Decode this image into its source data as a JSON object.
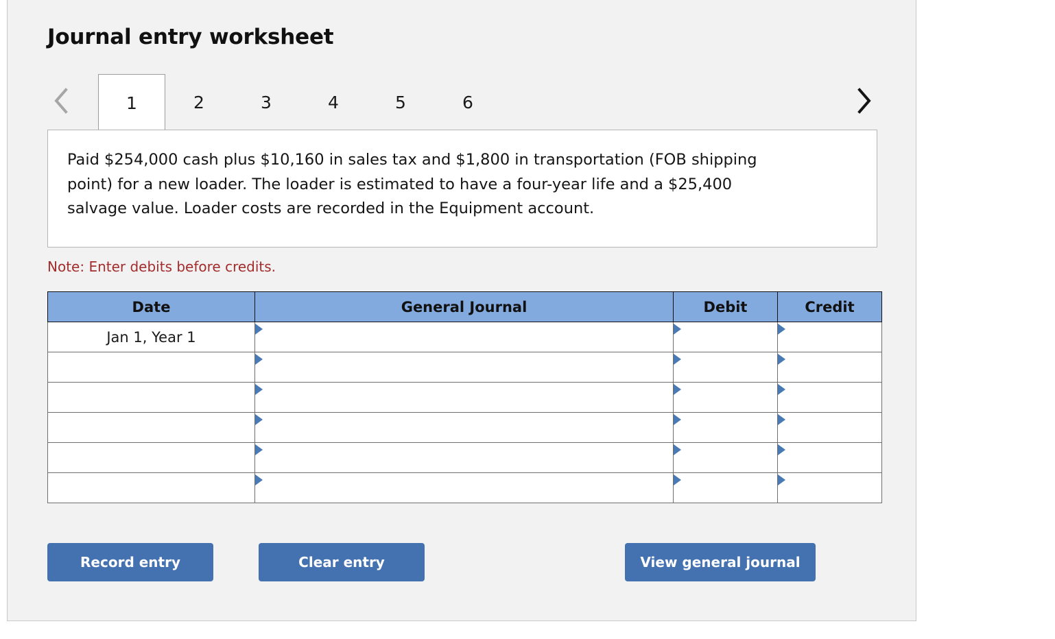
{
  "panel": {
    "title": "Journal entry worksheet"
  },
  "tabs": {
    "prev_icon": "chevron-left-icon",
    "next_icon": "chevron-right-icon",
    "items": [
      {
        "label": "1",
        "active": true
      },
      {
        "label": "2",
        "active": false
      },
      {
        "label": "3",
        "active": false
      },
      {
        "label": "4",
        "active": false
      },
      {
        "label": "5",
        "active": false
      },
      {
        "label": "6",
        "active": false
      }
    ]
  },
  "description": {
    "text": "Paid $254,000 cash plus $10,160 in sales tax and $1,800 in transportation (FOB shipping point) for a new loader. The loader is estimated to have a four-year life and a $25,400 salvage value. Loader costs are recorded in the Equipment account."
  },
  "note": {
    "text": "Note: Enter debits before credits."
  },
  "journal_table": {
    "headers": {
      "date": "Date",
      "general_journal": "General Journal",
      "debit": "Debit",
      "credit": "Credit"
    },
    "rows": [
      {
        "date": "Jan 1, Year 1",
        "general_journal": "",
        "debit": "",
        "credit": ""
      },
      {
        "date": "",
        "general_journal": "",
        "debit": "",
        "credit": ""
      },
      {
        "date": "",
        "general_journal": "",
        "debit": "",
        "credit": ""
      },
      {
        "date": "",
        "general_journal": "",
        "debit": "",
        "credit": ""
      },
      {
        "date": "",
        "general_journal": "",
        "debit": "",
        "credit": ""
      },
      {
        "date": "",
        "general_journal": "",
        "debit": "",
        "credit": ""
      }
    ]
  },
  "buttons": {
    "record_entry": "Record entry",
    "clear_entry": "Clear entry",
    "view_general_journal": "View general journal"
  },
  "colors": {
    "panel_background": "#f2f2f2",
    "header_blue": "#83aade",
    "button_blue": "#4472b0",
    "note_red": "#a32c2c",
    "combo_border_blue": "#4a7ab4"
  }
}
